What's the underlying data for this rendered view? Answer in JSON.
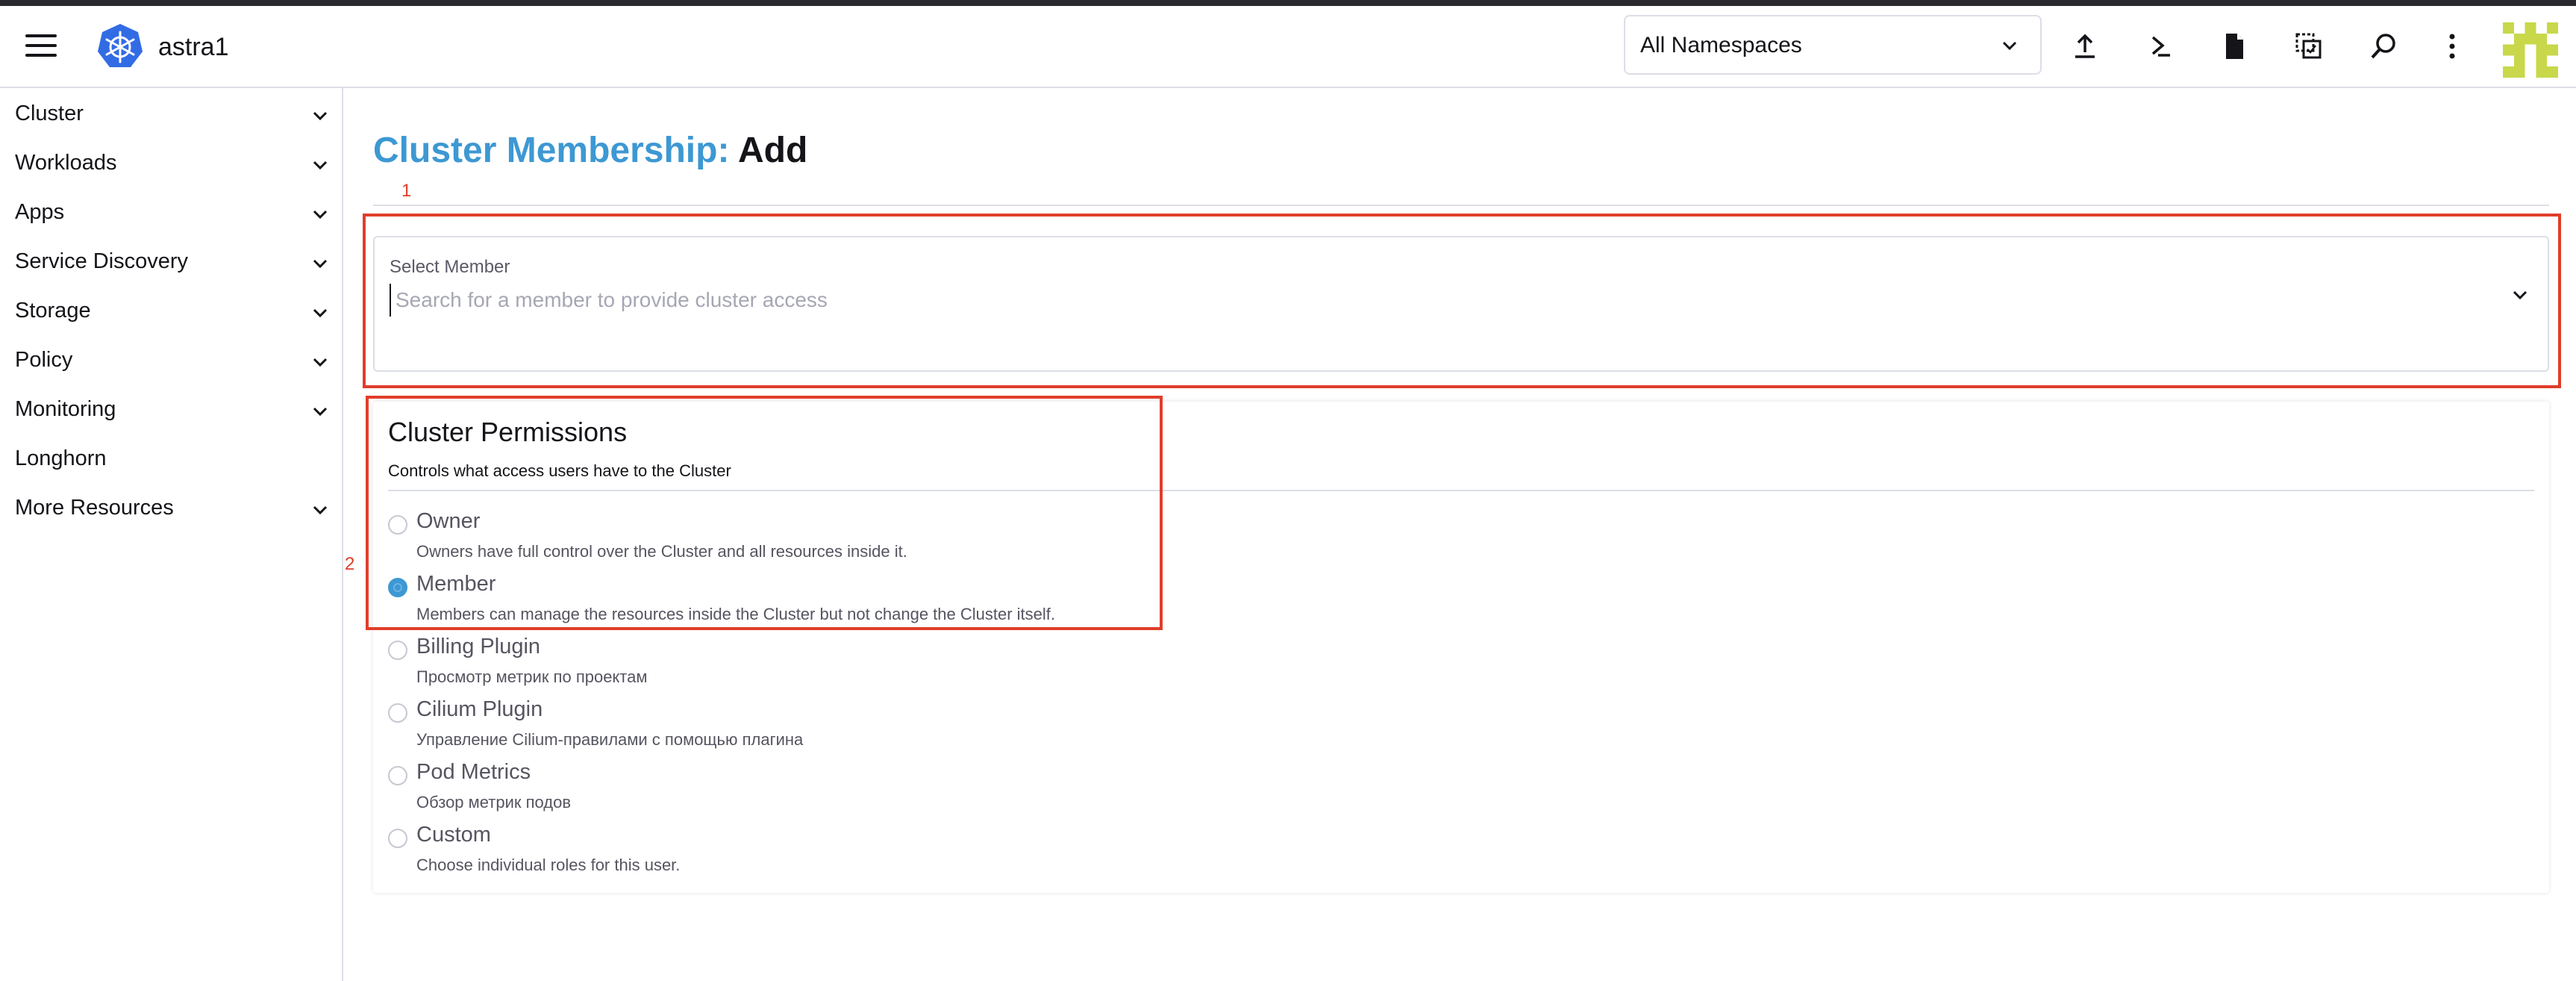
{
  "header": {
    "cluster_name": "astra1",
    "namespace_selected": "All Namespaces",
    "icons": [
      "hamburger-icon",
      "kubernetes-logo",
      "upload-icon",
      "terminal-icon",
      "file-icon",
      "copy-paste-icon",
      "search-icon",
      "more-vertical-icon",
      "avatar"
    ]
  },
  "sidebar": {
    "items": [
      {
        "label": "Cluster",
        "expandable": true
      },
      {
        "label": "Workloads",
        "expandable": true
      },
      {
        "label": "Apps",
        "expandable": true
      },
      {
        "label": "Service Discovery",
        "expandable": true
      },
      {
        "label": "Storage",
        "expandable": true
      },
      {
        "label": "Policy",
        "expandable": true
      },
      {
        "label": "Monitoring",
        "expandable": true
      },
      {
        "label": "Longhorn",
        "expandable": false
      },
      {
        "label": "More Resources",
        "expandable": true
      }
    ]
  },
  "page": {
    "title_accent": "Cluster Membership:",
    "title_rest": "Add"
  },
  "annotations": {
    "one": "1",
    "two": "2",
    "color": "#e03e2a"
  },
  "member_select": {
    "label": "Select Member",
    "placeholder": "Search for a member to provide cluster access",
    "value": ""
  },
  "permissions": {
    "title": "Cluster Permissions",
    "subtitle": "Controls what access users have to the Cluster",
    "selected": "Member",
    "options": [
      {
        "name": "Owner",
        "desc": "Owners have full control over the Cluster and all resources inside it."
      },
      {
        "name": "Member",
        "desc": "Members can manage the resources inside the Cluster but not change the Cluster itself."
      },
      {
        "name": "Billing Plugin",
        "desc": "Просмотр метрик по проектам"
      },
      {
        "name": "Cilium Plugin",
        "desc": "Управление Cilium-правилами с помощью плагина"
      },
      {
        "name": "Pod Metrics",
        "desc": "Обзор метрик подов"
      },
      {
        "name": "Custom",
        "desc": "Choose individual roles for this user."
      }
    ]
  },
  "colors": {
    "accent": "#3d98d3",
    "border": "#dcdee7",
    "text": "#141419"
  }
}
